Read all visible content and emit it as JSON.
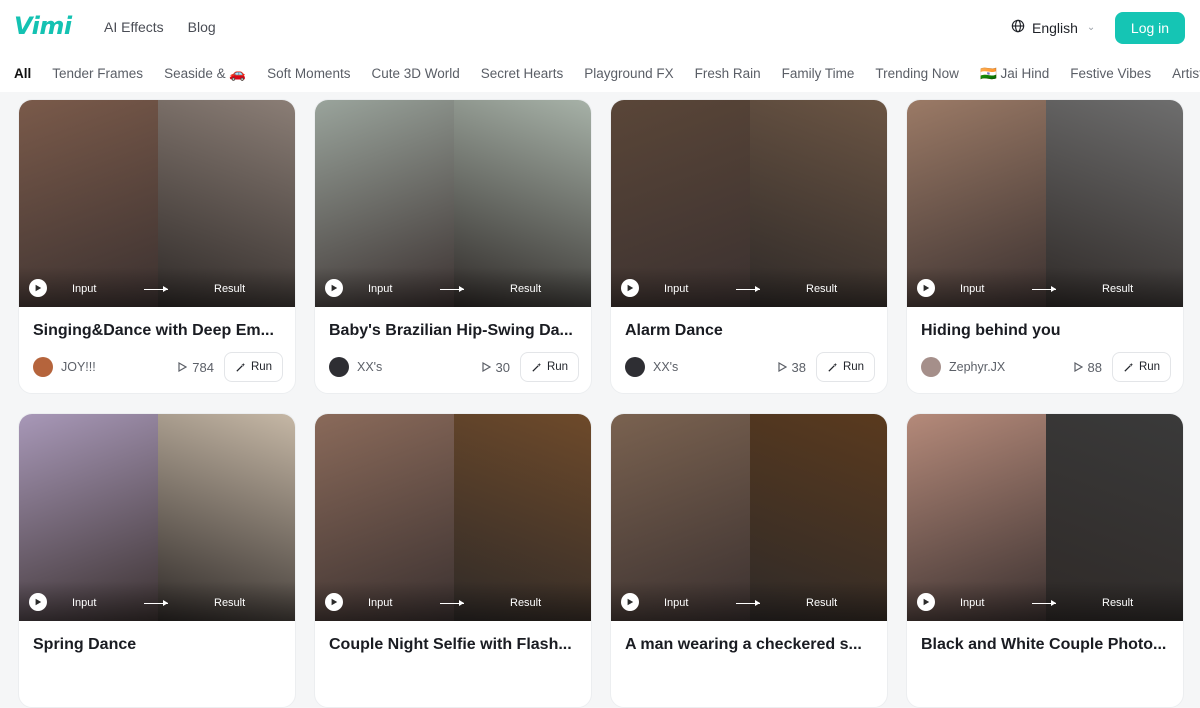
{
  "header": {
    "logo": "Vimi",
    "nav": [
      "AI Effects",
      "Blog"
    ],
    "language": "English",
    "login_label": "Log in"
  },
  "categories": [
    "All",
    "Tender Frames",
    "Seaside & 🚗",
    "Soft Moments",
    "Cute 3D World",
    "Secret Hearts",
    "Playground FX",
    "Fresh Rain",
    "Family Time",
    "Trending Now",
    "🇮🇳 Jai Hind",
    "Festive Vibes",
    "Artistic Styl"
  ],
  "active_category": "All",
  "card_labels": {
    "input": "Input",
    "result": "Result",
    "run": "Run"
  },
  "cards": [
    {
      "title": "Singing&Dance with Deep Em...",
      "author": "JOY!!!",
      "views": "784",
      "avatar_color": "#b5643c",
      "input_color": "#7a5a4a",
      "result_color": "#8b7e76"
    },
    {
      "title": "Baby's Brazilian Hip-Swing Da...",
      "author": "XX's",
      "views": "30",
      "avatar_color": "#2e2e33",
      "input_color": "#9aa49c",
      "result_color": "#a7b2a8"
    },
    {
      "title": "Alarm Dance",
      "author": "XX's",
      "views": "38",
      "avatar_color": "#2e2e33",
      "input_color": "#5a4638",
      "result_color": "#6b5544"
    },
    {
      "title": "Hiding behind you",
      "author": "Zephyr.JX",
      "views": "88",
      "avatar_color": "#a58f8a",
      "input_color": "#9b7a66",
      "result_color": "#6e6e6e"
    },
    {
      "title": "Spring Dance",
      "author": "",
      "views": "",
      "avatar_color": "#c49a7a",
      "input_color": "#a898b8",
      "result_color": "#c6b8a6"
    },
    {
      "title": "Couple Night Selfie with Flash...",
      "author": "",
      "views": "",
      "avatar_color": "#c49a7a",
      "input_color": "#8a6a5a",
      "result_color": "#6e4a2a"
    },
    {
      "title": "A man wearing a checkered s...",
      "author": "",
      "views": "",
      "avatar_color": "#c49a7a",
      "input_color": "#7a6250",
      "result_color": "#5a3a1e"
    },
    {
      "title": "Black and White Couple Photo...",
      "author": "",
      "views": "",
      "avatar_color": "#c49a7a",
      "input_color": "#b58a7a",
      "result_color": "#3a3a3a"
    }
  ]
}
